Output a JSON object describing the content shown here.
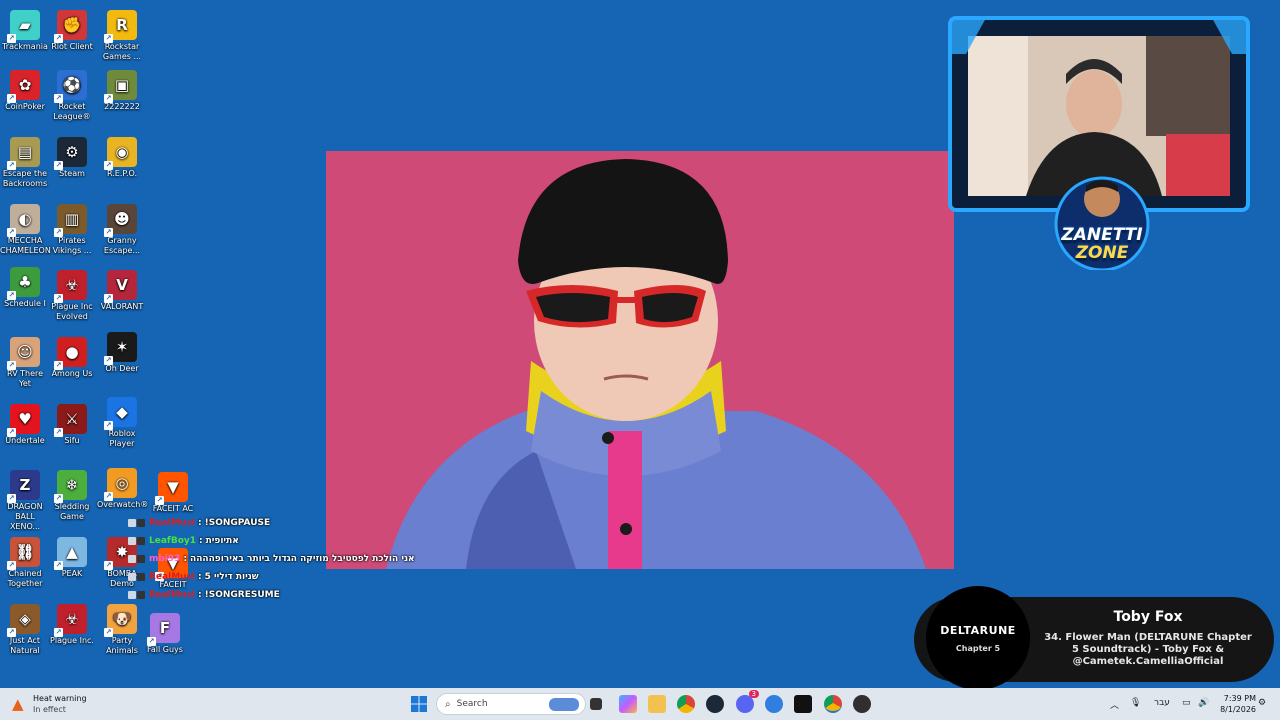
{
  "desktop_icons": [
    {
      "label": "Trackmania",
      "color": "#3fd0c8",
      "glyph": "▰"
    },
    {
      "label": "Riot Client",
      "color": "#d13639",
      "glyph": "✊"
    },
    {
      "label": "Rockstar Games ...",
      "color": "#f2b90f",
      "glyph": "R"
    },
    {
      "label": "CoinPoker",
      "color": "#d8232a",
      "glyph": "✿"
    },
    {
      "label": "Rocket League®",
      "color": "#2a6fd1",
      "glyph": "⚽"
    },
    {
      "label": "2222222",
      "color": "#6f8a3a",
      "glyph": "▣"
    },
    {
      "label": "Escape the Backrooms",
      "color": "#a89a52",
      "glyph": "▤"
    },
    {
      "label": "Steam",
      "color": "#1b2838",
      "glyph": "⚙"
    },
    {
      "label": "R.E.P.O.",
      "color": "#e8b422",
      "glyph": "◉"
    },
    {
      "label": "MECCHA CHAMELEON",
      "color": "#bfae9a",
      "glyph": "◐"
    },
    {
      "label": "Pirates Vikings ...",
      "color": "#7b5a2c",
      "glyph": "▥"
    },
    {
      "label": "Granny Escape...",
      "color": "#5a4638",
      "glyph": "☻"
    },
    {
      "label": "Schedule I",
      "color": "#3c9b3c",
      "glyph": "♣"
    },
    {
      "label": "Plague Inc Evolved",
      "color": "#c0202b",
      "glyph": "☣"
    },
    {
      "label": "VALORANT",
      "color": "#b5263c",
      "glyph": "V"
    },
    {
      "label": "RV There Yet",
      "color": "#d9a37a",
      "glyph": "☺"
    },
    {
      "label": "Among Us",
      "color": "#d11f1f",
      "glyph": "●"
    },
    {
      "label": "Oh Deer",
      "color": "#1a1a1a",
      "glyph": "✶"
    },
    {
      "label": "Undertale",
      "color": "#e3141e",
      "glyph": "♥"
    },
    {
      "label": "Sifu",
      "color": "#8c1a1a",
      "glyph": "⚔"
    },
    {
      "label": "Roblox Player",
      "color": "#1b74e4",
      "glyph": "◆"
    },
    {
      "label": "DRAGON BALL XENO...",
      "color": "#2d3a8c",
      "glyph": "Z"
    },
    {
      "label": "Sledding Game",
      "color": "#4cae3c",
      "glyph": "❄"
    },
    {
      "label": "Overwatch®",
      "color": "#f29b22",
      "glyph": "◎"
    },
    {
      "label": "FACEIT AC",
      "color": "#ff5500",
      "glyph": "▼"
    },
    {
      "label": "Chained Together",
      "color": "#c8533a",
      "glyph": "⛓"
    },
    {
      "label": "PEAK",
      "color": "#7fb7e3",
      "glyph": "▲"
    },
    {
      "label": "BOMBA Demo",
      "color": "#b52a2a",
      "glyph": "✸"
    },
    {
      "label": "FACEIT",
      "color": "#ff5500",
      "glyph": "▼"
    },
    {
      "label": "Just Act Natural",
      "color": "#8b5a2b",
      "glyph": "◈"
    },
    {
      "label": "Plague Inc.",
      "color": "#c0202b",
      "glyph": "☣"
    },
    {
      "label": "Party Animals",
      "color": "#f2a341",
      "glyph": "🐶"
    },
    {
      "label": "Fall Guys",
      "color": "#a678e3",
      "glyph": "F"
    }
  ],
  "chat": [
    {
      "user": "RealMusi",
      "user_color": "#e01b1b",
      "msg": "!SONGPAUSE"
    },
    {
      "user": "LeafBoy1",
      "user_color": "#4be13d",
      "msg": "אתיופית"
    },
    {
      "user": "mbi93",
      "user_color": "#ff5cd4",
      "msg": "אני הולכת לפסטיבל מוזיקה הגדול ביותר באירופהההה"
    },
    {
      "user": "RealMusi",
      "user_color": "#e01b1b",
      "msg": "שניות דיליי 5"
    },
    {
      "user": "RealMusi",
      "user_color": "#e01b1b",
      "msg": "!SONGRESUME"
    }
  ],
  "webcam": {
    "logo_top": "ZANETTI",
    "logo_bottom": "ZONE"
  },
  "now_playing": {
    "album_text": "DELTARUNE",
    "album_sub": "Chapter 5",
    "artist": "Toby Fox",
    "title": "34. Flower Man (DELTARUNE Chapter 5 Soundtrack) - Toby Fox & @Cametek.CamelliaOfficial"
  },
  "taskbar": {
    "weather_title": "Heat warning",
    "weather_sub": "In effect",
    "search_placeholder": "Search",
    "notification_count": "3",
    "language": "עבר",
    "time": "7:39 PM",
    "date": "8/1/2026"
  }
}
